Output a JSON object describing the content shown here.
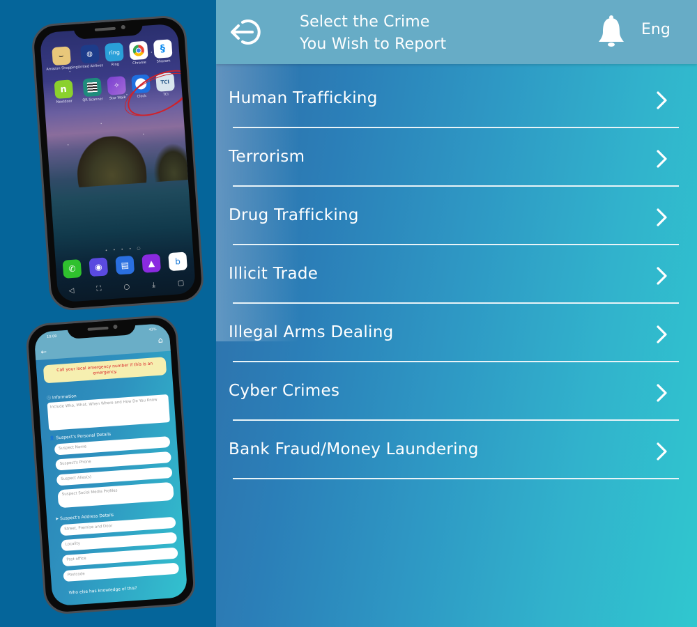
{
  "header": {
    "title_line1": "Select the Crime",
    "title_line2": "You Wish to Report",
    "back_icon": "logout-arrow-icon",
    "bell_icon": "bell-icon",
    "language": "Eng"
  },
  "crimes": [
    {
      "label": "Human Trafficking"
    },
    {
      "label": "Terrorism"
    },
    {
      "label": "Drug Trafficking"
    },
    {
      "label": "Illicit Trade"
    },
    {
      "label": "Illegal Arms Dealing"
    },
    {
      "label": "Cyber Crimes"
    },
    {
      "label": "Bank Fraud/Money Laundering"
    }
  ],
  "colors": {
    "left_bg": "#05659a",
    "header_bg": "#67acc6",
    "gradient_start": "#2f6ea8",
    "gradient_end": "#30c7cf",
    "highlight_circle": "#d0222a",
    "alert_bg": "#f6efb0",
    "alert_text": "#d8232a"
  },
  "phone_home": {
    "apps_row1": [
      {
        "label": "Amazon Shopping",
        "icon": "amazon-icon"
      },
      {
        "label": "United Airlines",
        "icon": "united-icon"
      },
      {
        "label": "Ring",
        "icon": "ring-icon",
        "glyph": "ring"
      },
      {
        "label": "Chrome",
        "icon": "chrome-icon"
      },
      {
        "label": "Shazam",
        "icon": "shazam-icon"
      }
    ],
    "apps_row2": [
      {
        "label": "Nextdoor",
        "icon": "nextdoor-icon",
        "glyph": "n"
      },
      {
        "label": "QR Scanner",
        "icon": "qr-icon"
      },
      {
        "label": "Star Walk",
        "icon": "starwalk-icon"
      },
      {
        "label": "Clock",
        "icon": "clock-icon"
      },
      {
        "label": "TCI",
        "icon": "tci-icon",
        "glyph": "TCI"
      }
    ],
    "page_dots": "• • • • ○",
    "dock": [
      "phone-icon",
      "camera-icon",
      "messages-icon",
      "gallery-icon",
      "bing-icon"
    ],
    "nav": [
      "◁",
      "⛶",
      "○",
      "⤓",
      "▢"
    ]
  },
  "phone_form": {
    "status_time": "10:08",
    "status_right": "43%",
    "alert": "Call your local emergency number if this is an emergency.",
    "info_label": "Information",
    "info_placeholder": "Include Who, What, When Where and How Do You Know",
    "personal_label": "Suspect's Personal Details",
    "personal_fields": [
      "Suspect Name",
      "Suspect's Phone",
      "Suspect Alias(s)",
      "Suspect Social Media Profiles"
    ],
    "address_label": "Suspect's Address Details",
    "address_fields": [
      "Street, Premise and Door",
      "Locality",
      "Post office",
      "Postcode"
    ],
    "footer_question": "Who else has knowledge of this?"
  }
}
